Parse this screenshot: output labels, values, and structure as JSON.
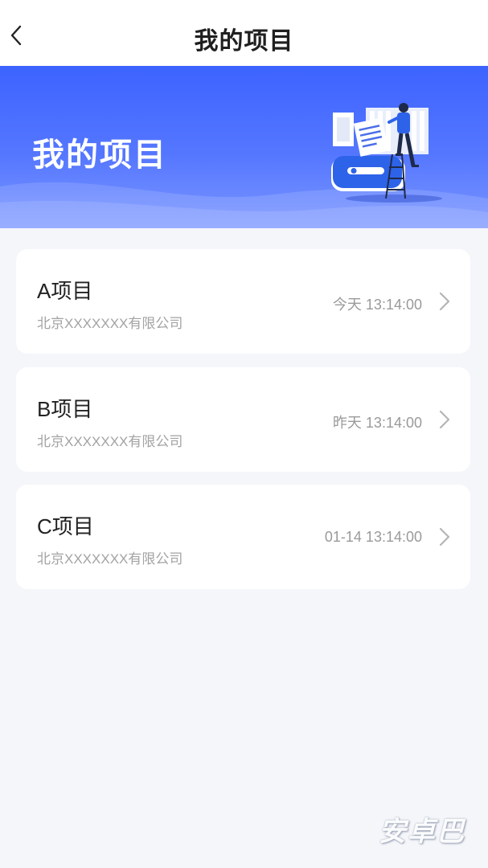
{
  "nav": {
    "title": "我的项目"
  },
  "banner": {
    "title": "我的项目"
  },
  "projects": [
    {
      "name": "A项目",
      "company": "北京XXXXXXX有限公司",
      "time": "今天 13:14:00"
    },
    {
      "name": "B项目",
      "company": "北京XXXXXXX有限公司",
      "time": "昨天 13:14:00"
    },
    {
      "name": "C项目",
      "company": "北京XXXXXXX有限公司",
      "time": "01-14 13:14:00"
    }
  ],
  "watermark": {
    "text": "安卓巴"
  },
  "colors": {
    "accent": "#3d63ff",
    "background": "#f5f6fa"
  },
  "icons": {
    "back": "chevron-left-icon",
    "row_arrow": "chevron-right-icon"
  }
}
